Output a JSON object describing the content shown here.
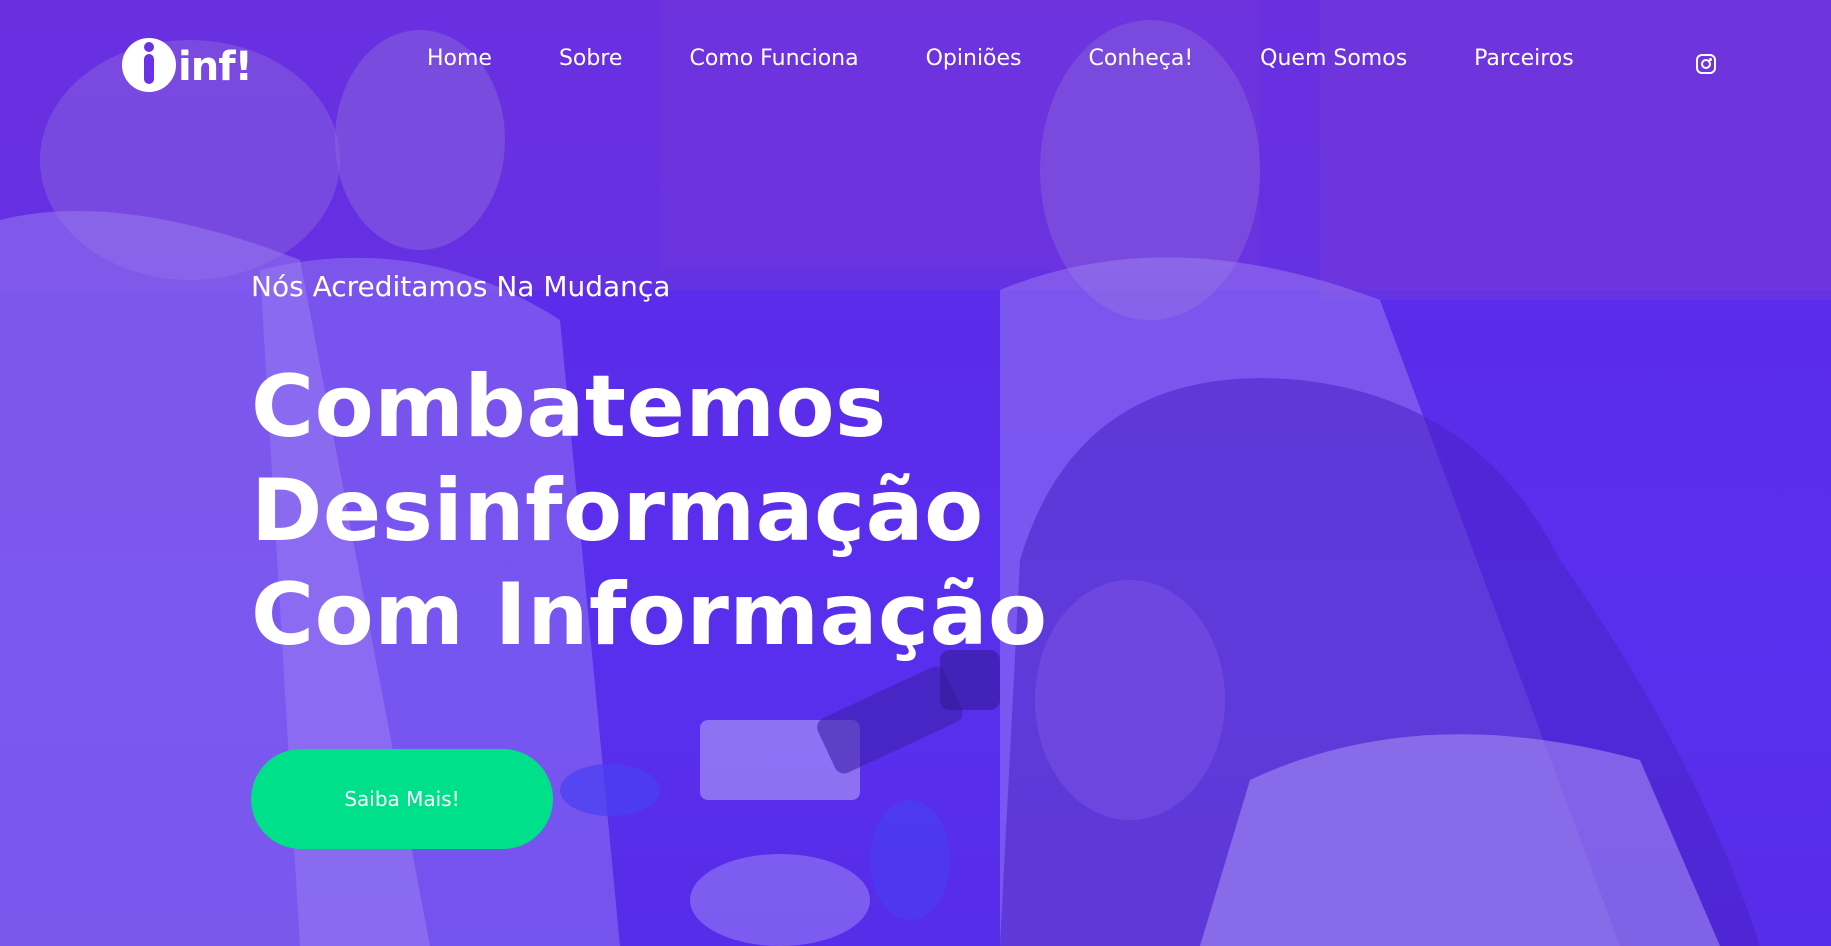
{
  "brand": {
    "logo_text": "inf!",
    "logo_icon": "logo-mark-icon"
  },
  "nav": {
    "items": [
      {
        "label": "Home"
      },
      {
        "label": "Sobre"
      },
      {
        "label": "Como Funciona"
      },
      {
        "label": "Opiniões"
      },
      {
        "label": "Conheça!"
      },
      {
        "label": "Quem Somos"
      },
      {
        "label": "Parceiros"
      }
    ],
    "social_icon": "instagram-icon"
  },
  "hero": {
    "tagline": "Nós Acreditamos Na Mudança",
    "headline_lines": [
      "Combatemos",
      "Desinformação",
      "Com Informação"
    ],
    "cta_label": "Saiba Mais!"
  },
  "colors": {
    "overlay": "#5a2ee6",
    "cta": "#00df8a",
    "text": "#ffffff"
  }
}
